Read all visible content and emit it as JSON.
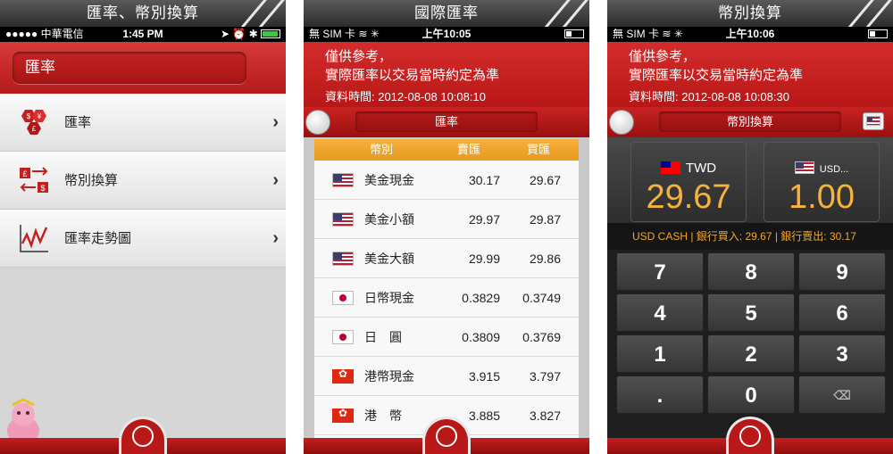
{
  "screen1": {
    "title": "匯率、幣別換算",
    "status": {
      "carrier": "●●●●● 中華電信 ",
      "time": "1:45 PM",
      "icons": "➤ ⏰ ✱ "
    },
    "search": {
      "value": "匯率"
    },
    "menu": [
      {
        "label": "匯率",
        "icon": "currency-exchange-icon"
      },
      {
        "label": "幣別換算",
        "icon": "currency-convert-icon"
      },
      {
        "label": "匯率走勢圖",
        "icon": "trend-chart-icon"
      }
    ],
    "chevron": "›"
  },
  "screen2": {
    "title": "國際匯率",
    "status": {
      "carrier": "無 SIM 卡 ",
      "time": "上午10:05"
    },
    "notice": {
      "line1": "僅供參考，",
      "line2": "實際匯率以交易當時約定為準",
      "time": "資料時間: 2012-08-08 10:08:10"
    },
    "selector": "匯率",
    "table": {
      "headers": [
        "幣別",
        "賣匯",
        "買匯"
      ],
      "rows": [
        {
          "flag": "us",
          "name": "美金現金",
          "sell": "30.17",
          "buy": "29.67"
        },
        {
          "flag": "us",
          "name": "美金小額",
          "sell": "29.97",
          "buy": "29.87"
        },
        {
          "flag": "us",
          "name": "美金大額",
          "sell": "29.99",
          "buy": "29.86"
        },
        {
          "flag": "jp",
          "name": "日幣現金",
          "sell": "0.3829",
          "buy": "0.3749"
        },
        {
          "flag": "jp",
          "name": "日　圓",
          "sell": "0.3809",
          "buy": "0.3769"
        },
        {
          "flag": "hk",
          "name": "港幣現金",
          "sell": "3.915",
          "buy": "3.797"
        },
        {
          "flag": "hk",
          "name": "港　幣",
          "sell": "3.885",
          "buy": "3.827"
        }
      ]
    }
  },
  "screen3": {
    "title": "幣別換算",
    "status": {
      "carrier": "無 SIM 卡 ",
      "time": "上午10:06"
    },
    "notice": {
      "line1": "僅供參考，",
      "line2": "實際匯率以交易當時約定為準",
      "time": "資料時間: 2012-08-08 10:08:30"
    },
    "selector": "幣別換算",
    "from": {
      "code": "TWD",
      "value": "29.67"
    },
    "to": {
      "code": "USD...",
      "value": "1.00"
    },
    "rate_info": "USD CASH | 銀行買入: 29.67 | 銀行賣出: 30.17",
    "keys": [
      "7",
      "8",
      "9",
      "4",
      "5",
      "6",
      "1",
      "2",
      "3",
      ".",
      "0",
      "⌫"
    ]
  },
  "colors": {
    "brand_red": "#c41e1e",
    "accent_orange": "#f6b23a",
    "table_header": "#f0a32a"
  }
}
